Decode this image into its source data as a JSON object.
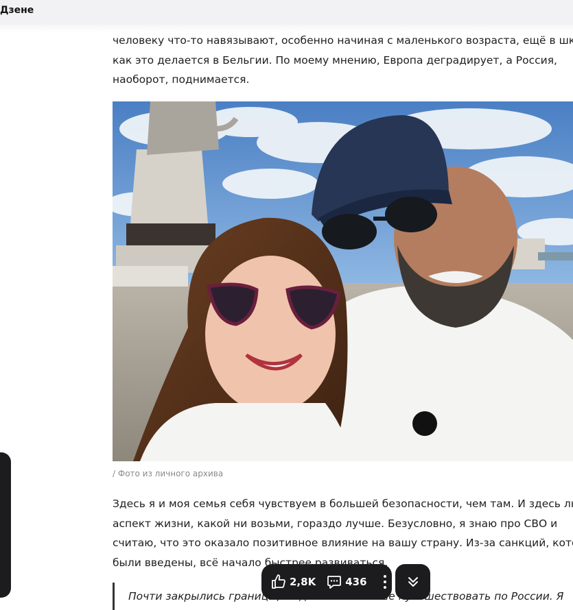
{
  "header": {
    "title": "Дзене"
  },
  "article": {
    "paragraph1": [
      "человеку что-то навязывают, особенно начиная с маленького возраста, ещё в школе,",
      "как это делается в Бельгии. По моему мнению, Европа деградирует, а Россия,",
      "наоборот, поднимается."
    ],
    "photo_caption": "/ Фото из личного архива",
    "paragraph2": [
      "Здесь я и моя семья себя чувствуем в большей безопасности, чем там. И здесь любой",
      "аспект жизни, какой ни возьми, гораздо лучше. Безусловно, я знаю про СВО и",
      "считаю, что это оказало позитивное влияние на вашу страну. Из-за санкций, которые",
      "были введены, всё начало быстрее развиваться."
    ],
    "quote": "Почти закрылись границы, люди стали больше путешествовать по России. Я"
  },
  "actions": {
    "likes": "2,8K",
    "comments": "436",
    "like_icon": "thumbs-up-icon",
    "comment_icon": "comment-icon",
    "more_icon": "more-vertical-icon",
    "scroll_icon": "double-chevron-down-icon"
  }
}
